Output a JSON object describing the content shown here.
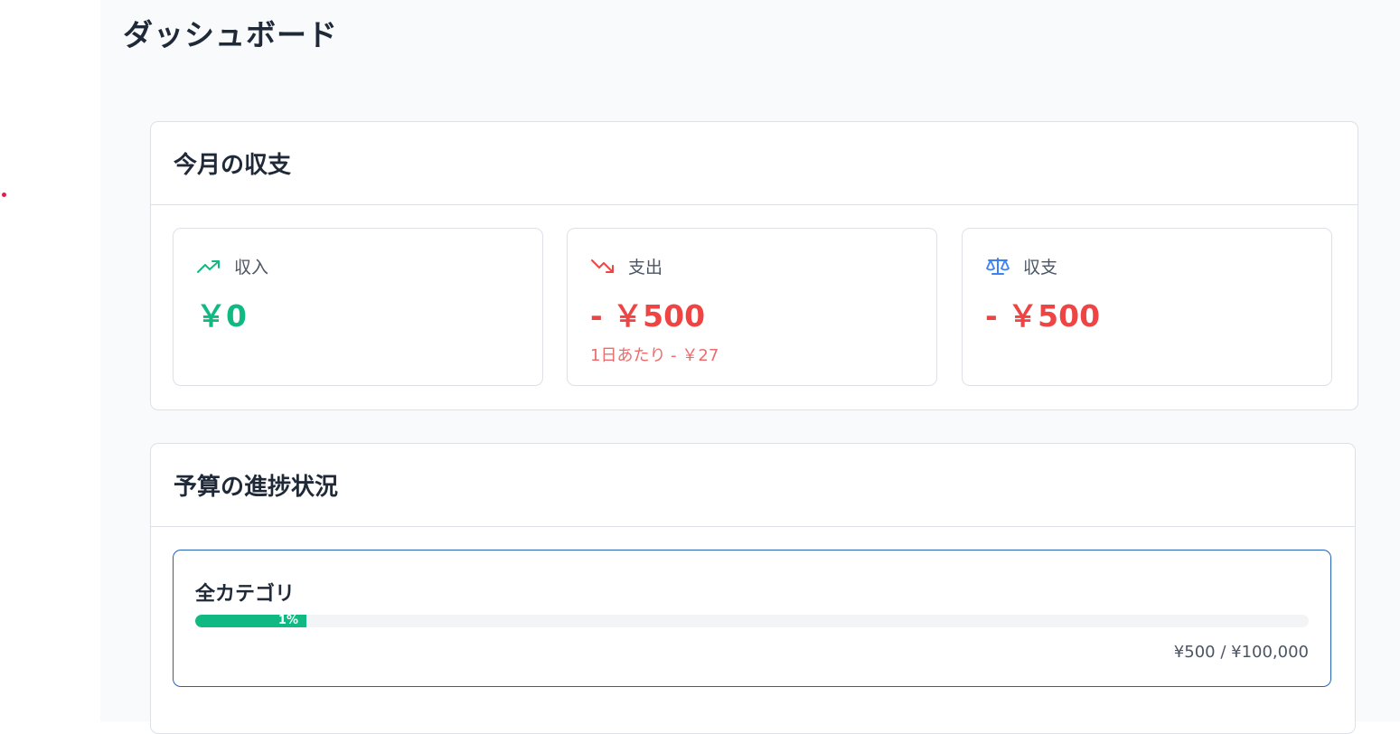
{
  "page": {
    "title": "ダッシュボード"
  },
  "monthly": {
    "title": "今月の収支",
    "income": {
      "label": "収入",
      "value": "￥0",
      "icon": "trending-up-icon",
      "color": "#10b981"
    },
    "expense": {
      "label": "支出",
      "value": "- ￥500",
      "sub": "1日あたり - ￥27",
      "icon": "trending-down-icon",
      "color": "#ef4444"
    },
    "balance": {
      "label": "収支",
      "value": "- ￥500",
      "icon": "scale-icon",
      "color": "#ef4444"
    }
  },
  "budget": {
    "title": "予算の進捗状況",
    "items": [
      {
        "name": "全カテゴリ",
        "percent_label": "1%",
        "progress": 0.01,
        "amount": "¥500 / ¥100,000",
        "bar_color": "#10b981"
      }
    ]
  }
}
